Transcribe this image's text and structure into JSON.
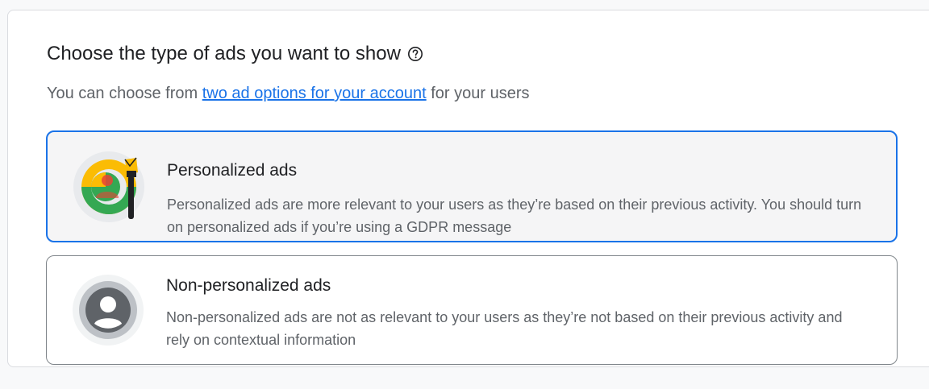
{
  "section": {
    "title": "Choose the type of ads you want to show",
    "help_icon": "help-circle-icon",
    "subtitle_prefix": "You can choose from ",
    "subtitle_link": "two ad options for your account",
    "subtitle_suffix": " for your users"
  },
  "options": [
    {
      "title": "Personalized ads",
      "description": "Personalized ads are more relevant to your users as they’re based on their previous activity. You should turn on personalized ads if you’re using a GDPR message",
      "selected": true,
      "icon": "personalized-user-icon"
    },
    {
      "title": "Non-personalized ads",
      "description": "Non-personalized ads are not as relevant to your users as they’re not based on their previous activity and rely on contextual information",
      "selected": false,
      "icon": "generic-user-icon"
    }
  ],
  "colors": {
    "accent": "#1a73e8",
    "selected_bg": "#f5f5f6",
    "border": "#80868b"
  }
}
